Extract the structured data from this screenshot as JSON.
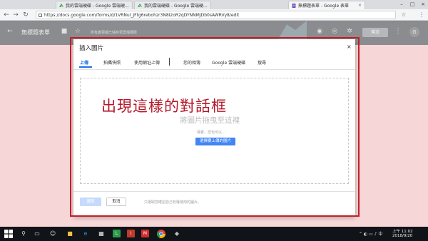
{
  "browser": {
    "tabs": [
      {
        "title": "我的雲端硬碟 - Google 雲端硬...",
        "close": "×"
      },
      {
        "title": "我的雲端硬碟 - Google 雲端硬...",
        "close": "×"
      },
      {
        "title": "無標題表單 - Google 表單",
        "close": "×"
      }
    ],
    "url": "https://docs.google.com/forms/d/1VRNul_JFtg6rebohzr3N8I2oR2qDYNNMJDb0sAWRVy8/edit",
    "window_controls": {
      "minimize": "–",
      "maximize": "□",
      "close": "×"
    }
  },
  "forms_header": {
    "title": "無標題表單",
    "subtitle": "所有變更都已儲存至雲端硬碟",
    "send_label": "傳送",
    "avatar_initial": "G"
  },
  "dialog": {
    "title": "插入圖片",
    "close": "×",
    "tabs": [
      "上傳",
      "拍攝快照",
      "使用網址上傳",
      "您的相簿",
      "Google 雲端硬碟",
      "搜尋"
    ],
    "active_tab": "上傳",
    "drag_text": "將圖片拖曳至這裡",
    "or_text": "或者，您也可以...",
    "pick_button": "選擇要上傳的圖片",
    "select_button": "選取",
    "cancel_button": "取消",
    "footnote": "只選取您確認自己有權使用的圖片。"
  },
  "annotation": {
    "text": "出現這樣的對話框",
    "color": "#b3192a"
  },
  "taskbar": {
    "tray_lang": "中",
    "ampm_time": "上午 11:02",
    "date": "2018/9/20"
  },
  "colors": {
    "accent": "#1a73e8",
    "button_blue": "#4285f4",
    "frame_red": "#c0202a",
    "page_pink": "#f6d6d6"
  }
}
